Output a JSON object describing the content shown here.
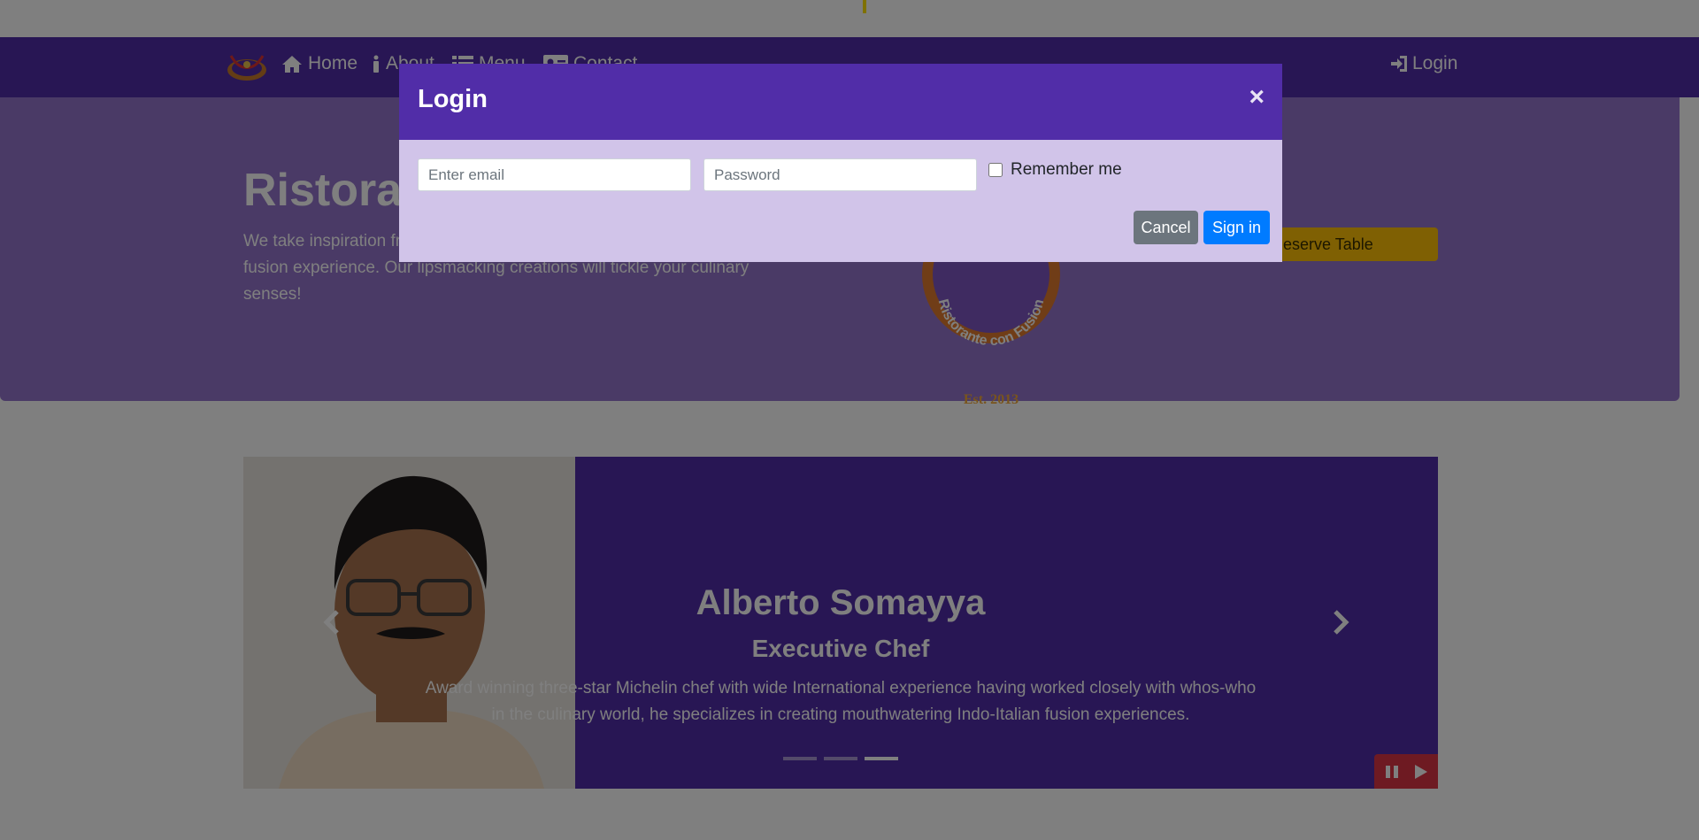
{
  "nav": {
    "items": [
      {
        "label": "Home",
        "icon": "home-icon"
      },
      {
        "label": "About",
        "icon": "info-icon"
      },
      {
        "label": "Menu",
        "icon": "list-icon"
      },
      {
        "label": "Contact",
        "icon": "address-card-icon"
      }
    ],
    "login": {
      "label": "Login",
      "icon": "sign-in-icon"
    }
  },
  "jumbotron": {
    "title": "Ristorante con Fusion",
    "text": "We take inspiration from the World's best cuisines, and create a unique fusion experience. Our lipsmacking creations will tickle your culinary senses!",
    "reserve_label": "Reserve Table",
    "logo_text_arc": "Ristorante con Fusion",
    "logo_est": "Est. 2013"
  },
  "carousel": {
    "name": "Alberto Somayya",
    "role": "Executive Chef",
    "description": "Award winning three-star Michelin chef with wide International experience having worked closely with whos-who in the culinary world, he specializes in creating mouthwatering Indo-Italian fusion experiences.",
    "active_indicator": 2,
    "indicator_count": 3
  },
  "modal": {
    "title": "Login",
    "close": "×",
    "email_placeholder": "Enter email",
    "password_placeholder": "Password",
    "remember_label": "Remember me",
    "cancel_label": "Cancel",
    "signin_label": "Sign in"
  },
  "colors": {
    "primary": "#512da8",
    "jumbotron": "#9575cd",
    "modal_body": "#d1c4e9",
    "reserve": "#ffc107",
    "signin": "#007bff",
    "cancel": "#6c757d",
    "carousel_controls": "#dc3545"
  }
}
